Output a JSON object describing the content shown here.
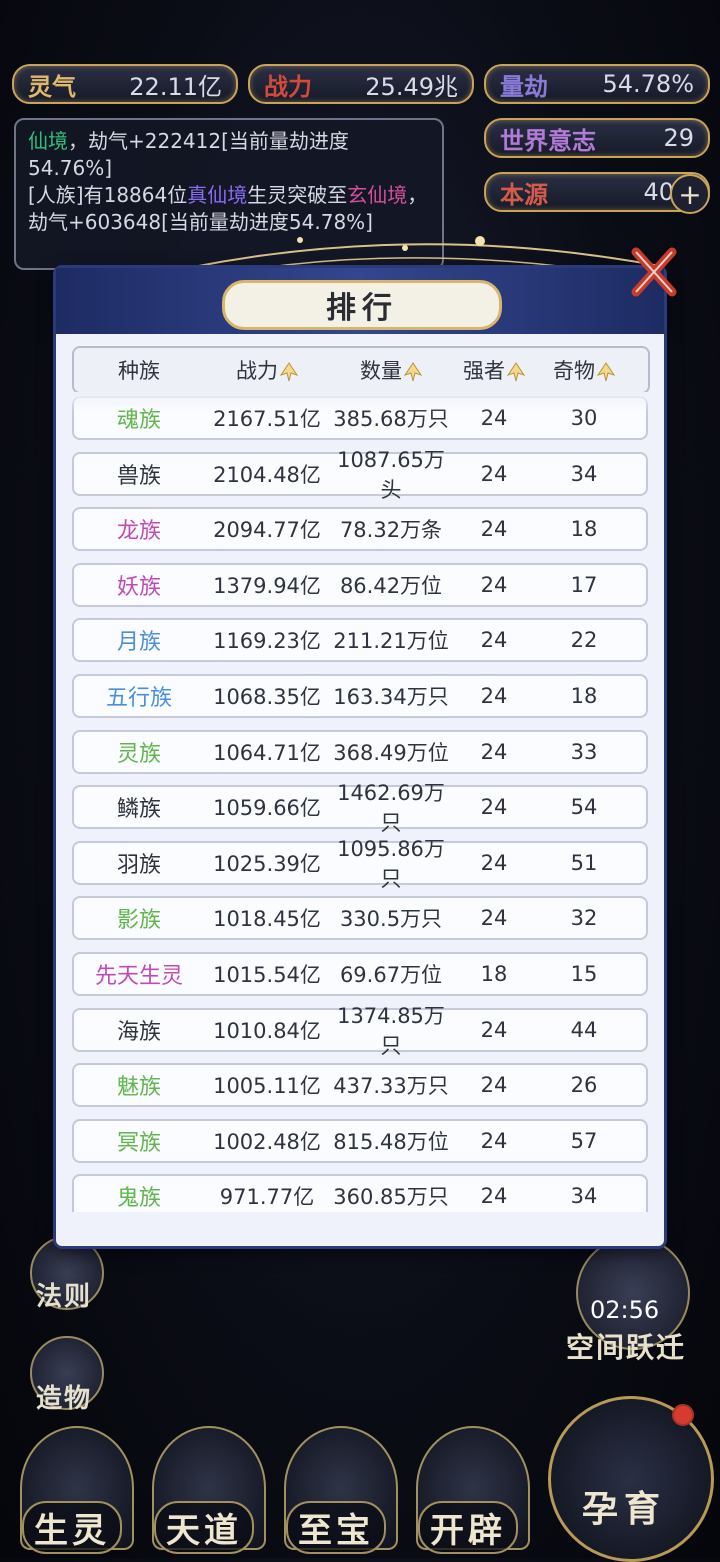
{
  "top_stats": [
    {
      "label": "灵气",
      "value": "22.11亿",
      "color": "#e2b86a"
    },
    {
      "label": "战力",
      "value": "25.49兆",
      "color": "#d24a3a"
    },
    {
      "label": "量劫",
      "value": "54.78%",
      "color": "#8a7bd8"
    }
  ],
  "right_stats": [
    {
      "label": "世界意志",
      "value": "29",
      "color": "#b07ad6"
    },
    {
      "label": "本源",
      "value": "40",
      "color": "#d45b4a"
    }
  ],
  "log": {
    "line1_a": "仙境",
    "line1_b": "，劫气+222412[当前量劫进度54.76%]",
    "line2_a": "[人族]有18864位",
    "line2_b": "真仙境",
    "line2_c": "生灵突破至",
    "line2_d": "玄仙境",
    "line2_e": "，劫气+603648[当前量劫进度54.78%]"
  },
  "dialog": {
    "title": "排行",
    "headers": [
      "种族",
      "战力",
      "数量",
      "强者",
      "奇物"
    ]
  },
  "rows": [
    {
      "name": "魂族",
      "power": "2167.51亿",
      "count": "385.68万只",
      "strong": "24",
      "items": "30",
      "color": "#5fb64a"
    },
    {
      "name": "兽族",
      "power": "2104.48亿",
      "count": "1087.65万头",
      "strong": "24",
      "items": "34",
      "color": "#2f3340"
    },
    {
      "name": "龙族",
      "power": "2094.77亿",
      "count": "78.32万条",
      "strong": "24",
      "items": "18",
      "color": "#c14bb4"
    },
    {
      "name": "妖族",
      "power": "1379.94亿",
      "count": "86.42万位",
      "strong": "24",
      "items": "17",
      "color": "#c14bb4"
    },
    {
      "name": "月族",
      "power": "1169.23亿",
      "count": "211.21万位",
      "strong": "24",
      "items": "22",
      "color": "#4a8ee0"
    },
    {
      "name": "五行族",
      "power": "1068.35亿",
      "count": "163.34万只",
      "strong": "24",
      "items": "18",
      "color": "#4a8ee0"
    },
    {
      "name": "灵族",
      "power": "1064.71亿",
      "count": "368.49万位",
      "strong": "24",
      "items": "33",
      "color": "#5fb64a"
    },
    {
      "name": "鳞族",
      "power": "1059.66亿",
      "count": "1462.69万只",
      "strong": "24",
      "items": "54",
      "color": "#2f3340"
    },
    {
      "name": "羽族",
      "power": "1025.39亿",
      "count": "1095.86万只",
      "strong": "24",
      "items": "51",
      "color": "#2f3340"
    },
    {
      "name": "影族",
      "power": "1018.45亿",
      "count": "330.5万只",
      "strong": "24",
      "items": "32",
      "color": "#5fb64a"
    },
    {
      "name": "先天生灵",
      "power": "1015.54亿",
      "count": "69.67万位",
      "strong": "18",
      "items": "15",
      "color": "#c14bb4"
    },
    {
      "name": "海族",
      "power": "1010.84亿",
      "count": "1374.85万只",
      "strong": "24",
      "items": "44",
      "color": "#2f3340"
    },
    {
      "name": "魅族",
      "power": "1005.11亿",
      "count": "437.33万只",
      "strong": "24",
      "items": "26",
      "color": "#5fb64a"
    },
    {
      "name": "冥族",
      "power": "1002.48亿",
      "count": "815.48万位",
      "strong": "24",
      "items": "57",
      "color": "#5fb64a"
    },
    {
      "name": "鬼族",
      "power": "971.77亿",
      "count": "360.85万只",
      "strong": "24",
      "items": "34",
      "color": "#5fb64a"
    }
  ],
  "side": {
    "fa_ze": "法则",
    "zao_wu": "造物"
  },
  "bottom_nav": [
    "生灵",
    "天道",
    "至宝",
    "开辟"
  ],
  "timer": "02:56",
  "jump_label": "空间跃迁",
  "yun_label": "孕育"
}
